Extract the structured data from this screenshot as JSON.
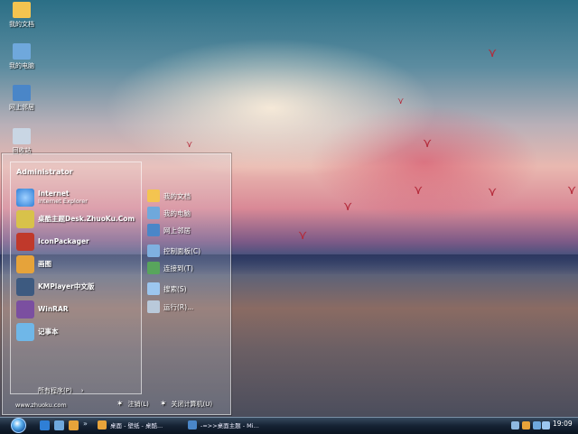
{
  "desktop": {
    "icons": [
      {
        "label": "我的文档",
        "icon": "folder-icon",
        "color": "#f4c450"
      },
      {
        "label": "我的电脑",
        "icon": "computer-icon",
        "color": "#6fa8dc"
      },
      {
        "label": "网上邻居",
        "icon": "network-icon",
        "color": "#4a86c8"
      },
      {
        "label": "回收站",
        "icon": "recycle-bin-icon",
        "color": "#c9d6e4"
      }
    ]
  },
  "start_menu": {
    "user": "Administrator",
    "left_items": [
      {
        "title": "Internet",
        "subtitle": "Internet Explorer",
        "icon": "internet-explorer-icon",
        "color": "#2f7fd6"
      },
      {
        "title": "桌酷主题Desk.ZhuoKu.Com",
        "icon": "desk-theme-icon",
        "color": "#d8c24a"
      },
      {
        "title": "IconPackager",
        "icon": "iconpackager-icon",
        "color": "#c0392b"
      },
      {
        "title": "画图",
        "icon": "paint-icon",
        "color": "#e6a33a"
      },
      {
        "title": "KMPlayer中文版",
        "icon": "kmplayer-icon",
        "color": "#3d5a80"
      },
      {
        "title": "WinRAR",
        "icon": "winrar-icon",
        "color": "#7b4fa0"
      },
      {
        "title": "记事本",
        "icon": "notepad-icon",
        "color": "#6fb7e8"
      }
    ],
    "all_programs": "所有程序(P)",
    "right_items": [
      {
        "label": "我的文档",
        "icon": "documents-folder-icon",
        "color": "#f4c450"
      },
      {
        "label": "我的电脑",
        "icon": "my-computer-icon",
        "color": "#6fa8dc"
      },
      {
        "label": "网上邻居",
        "icon": "network-places-icon",
        "color": "#4a86c8"
      },
      {
        "label": "控制面板(C)",
        "icon": "control-panel-icon",
        "color": "#7fb0e0"
      },
      {
        "label": "连接到(T)",
        "icon": "connect-to-icon",
        "color": "#58a55c"
      },
      {
        "label": "搜索(S)",
        "icon": "search-icon",
        "color": "#9cc6ef"
      },
      {
        "label": "运行(R)...",
        "icon": "run-icon",
        "color": "#b9c9da"
      }
    ],
    "footer_url": "www.zhuoku.com",
    "log_off": "注销(L)",
    "shut_down": "关闭计算机(U)"
  },
  "taskbar": {
    "quick_launch": [
      {
        "icon": "ie-quicklaunch-icon",
        "color": "#2f7fd6"
      },
      {
        "icon": "desktop-quicklaunch-icon",
        "color": "#6fa8dc"
      },
      {
        "icon": "media-quicklaunch-icon",
        "color": "#e6a33a"
      }
    ],
    "windows": [
      {
        "label": "桌面 - 壁纸 - 桌酷...",
        "icon": "browser-window-icon",
        "color": "#e8a33a"
      },
      {
        "label": "-=>>桌面主题 - Mi...",
        "icon": "word-window-icon",
        "color": "#4a86c8"
      }
    ],
    "clock": "19:09"
  }
}
